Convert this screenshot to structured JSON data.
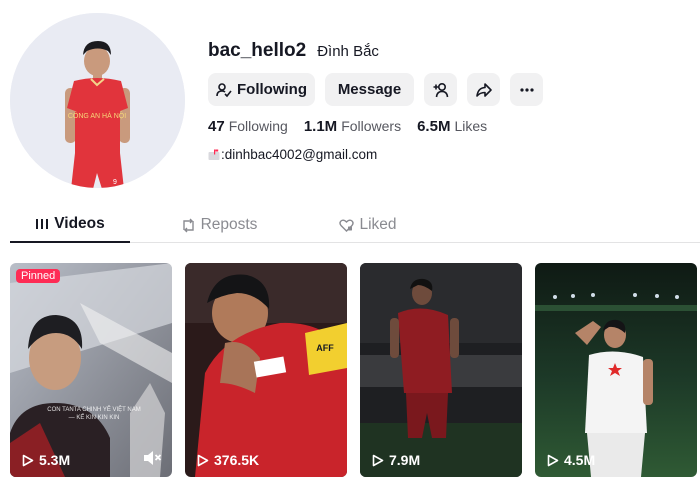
{
  "profile": {
    "username": "bac_hello2",
    "nickname": "Đình Bắc",
    "bio": ":dinhbac4002@gmail.com",
    "avatar_jersey_text": "CÔNG AN HÀ NỘI",
    "avatar_jersey_number": "9"
  },
  "actions": {
    "following_label": "Following",
    "message_label": "Message",
    "add_friend_icon": "add-friend-icon",
    "share_icon": "share-icon",
    "more_icon": "more-icon"
  },
  "stats": [
    {
      "value": "47",
      "label": "Following"
    },
    {
      "value": "1.1M",
      "label": "Followers"
    },
    {
      "value": "6.5M",
      "label": "Likes"
    }
  ],
  "tabs": [
    {
      "label": "Videos",
      "icon": "grid-icon",
      "active": true
    },
    {
      "label": "Reposts",
      "icon": "repost-icon",
      "active": false
    },
    {
      "label": "Liked",
      "icon": "heart-icon",
      "active": false
    }
  ],
  "videos": [
    {
      "views": "5.3M",
      "pinned_label": "Pinned",
      "caption": "CON TANTA CHINH YÊ VIỆT NAM — KẾ KIN KIN KIN"
    },
    {
      "views": "376.5K",
      "armband": "AFF"
    },
    {
      "views": "7.9M"
    },
    {
      "views": "4.5M"
    }
  ],
  "colors": {
    "accent": "#fe2c55",
    "text": "#161823",
    "muted": "#8a8b91",
    "button_bg": "#f1f1f2",
    "jersey_red": "#e1343c"
  }
}
